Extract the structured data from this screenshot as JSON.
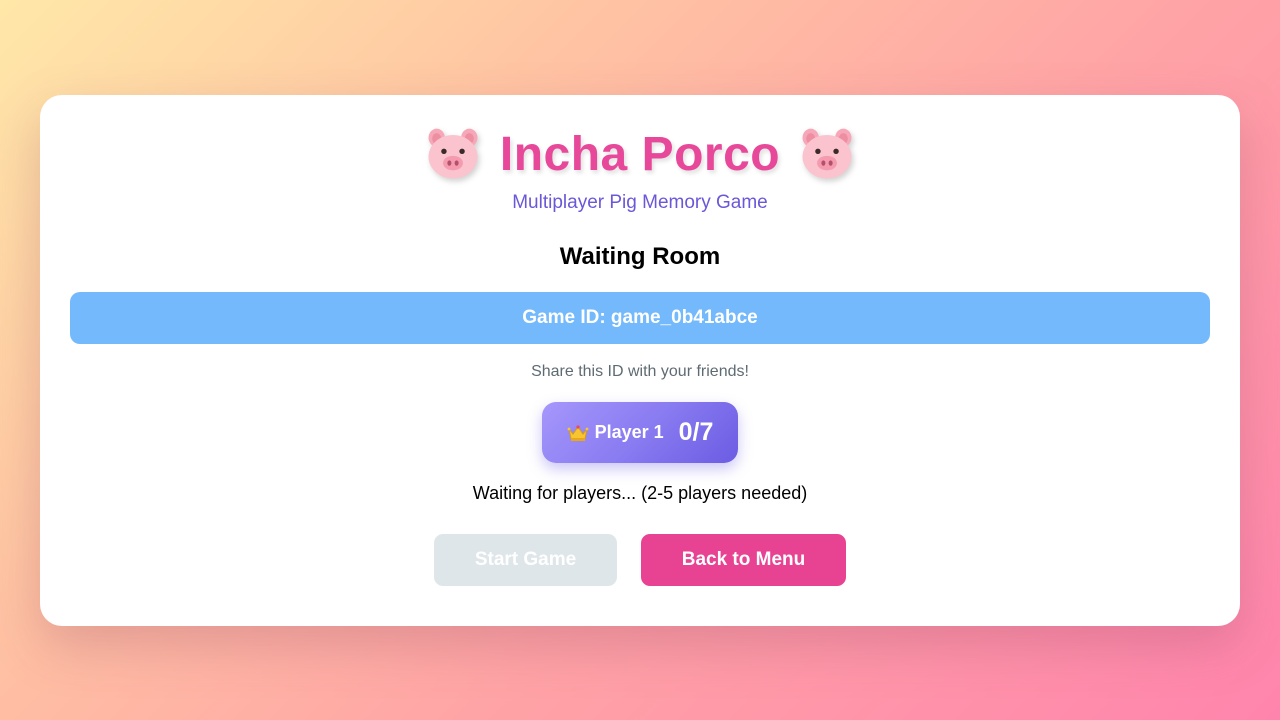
{
  "header": {
    "title": "Incha Porco",
    "subtitle": "Multiplayer Pig Memory Game",
    "title_icon": "pig-face-icon"
  },
  "room": {
    "heading": "Waiting Room",
    "game_id_text": "Game ID: game_0b41abce",
    "share_hint": "Share this ID with your friends!",
    "status_text": "Waiting for players... (2-5 players needed)"
  },
  "players": [
    {
      "icon": "crown-icon",
      "name": "Player 1",
      "score": "0/7"
    }
  ],
  "actions": {
    "start_label": "Start Game",
    "start_enabled": false,
    "back_label": "Back to Menu"
  },
  "colors": {
    "title": "#e8489a",
    "subtitle": "#6a58d8",
    "game_id_bar": "#74b9fc",
    "player_chip": "#8a7cf1",
    "start_disabled": "#dfe6e9",
    "back_button": "#e84393"
  }
}
